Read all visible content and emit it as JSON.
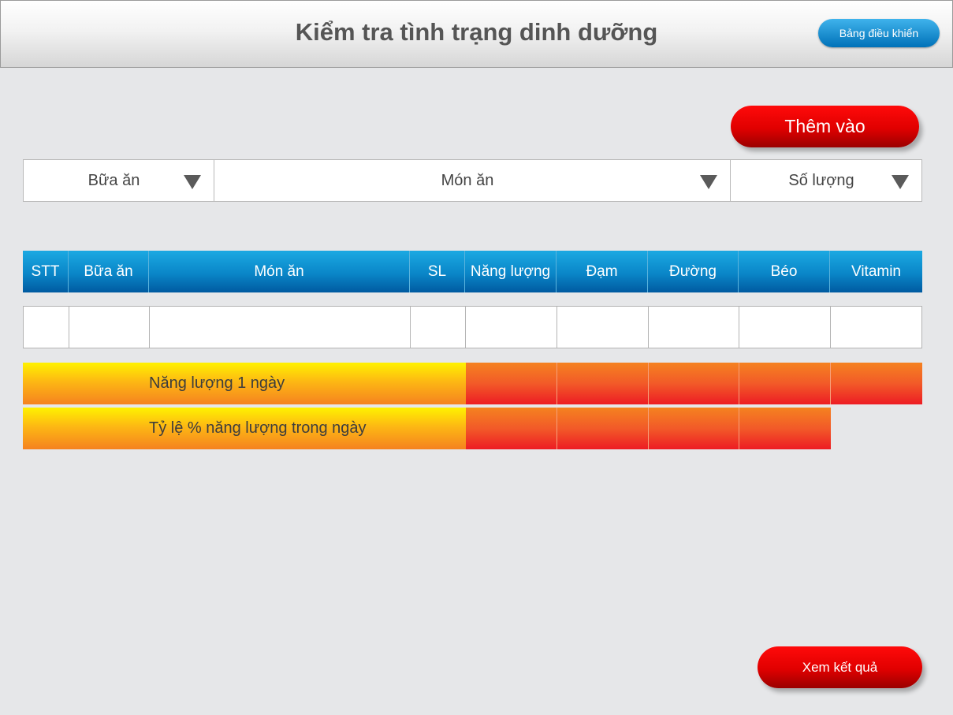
{
  "header": {
    "title": "Kiểm tra tình trạng dinh dưỡng",
    "dashboard_button": "Bảng điều khiển"
  },
  "actions": {
    "add_label": "Thêm vào",
    "result_label": "Xem kết quả"
  },
  "selectors": [
    {
      "label": "Bữa ăn",
      "icon": "triangle-down-icon"
    },
    {
      "label": "Món ăn",
      "icon": "triangle-down-icon"
    },
    {
      "label": "Số lượng",
      "icon": "triangle-down-icon"
    }
  ],
  "table": {
    "columns": [
      "STT",
      "Bữa ăn",
      "Món ăn",
      "SL",
      "Năng lượng",
      "Đạm",
      "Đường",
      "Béo",
      "Vitamin"
    ]
  },
  "summary": {
    "daily_energy_label": "Năng lượng 1 ngày",
    "daily_percent_label": "Tỷ lệ % năng lượng trong ngày"
  },
  "colors": {
    "header_accent": "#0a86c8",
    "action_red": "#e00000",
    "summary_yellow": "#fff200",
    "summary_orange": "#f25a28",
    "background": "#e6e7e9"
  }
}
